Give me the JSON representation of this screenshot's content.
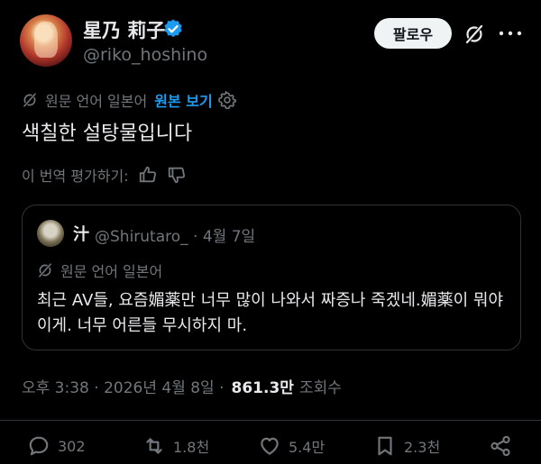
{
  "author": {
    "name": "星乃 莉子",
    "handle": "@riko_hoshino",
    "follow_label": "팔로우",
    "verified_color": "#1d9bf0"
  },
  "translation": {
    "label": "원문 언어 일본어",
    "show_original": "원본 보기"
  },
  "tweet_text": "색칠한 설탕물입니다",
  "rate_translation": "이 번역 평가하기:",
  "quote": {
    "name": "汁",
    "handle_date": "@Shirutaro_ · 4월 7일",
    "translation_label": "원문 언어 일본어",
    "text": "최근 AV들, 요즘媚薬만 너무 많이 나와서 짜증나 죽겠네.媚薬이 뭐야 이게. 너무 어른들 무시하지 마."
  },
  "meta": {
    "timestamp": "오후 3:38 · 2026년 4월 8일 ·",
    "views": "861.3만",
    "views_label": "조회수"
  },
  "actions": {
    "replies": "302",
    "reposts": "1.8천",
    "likes": "5.4만",
    "bookmarks": "2.3천"
  }
}
